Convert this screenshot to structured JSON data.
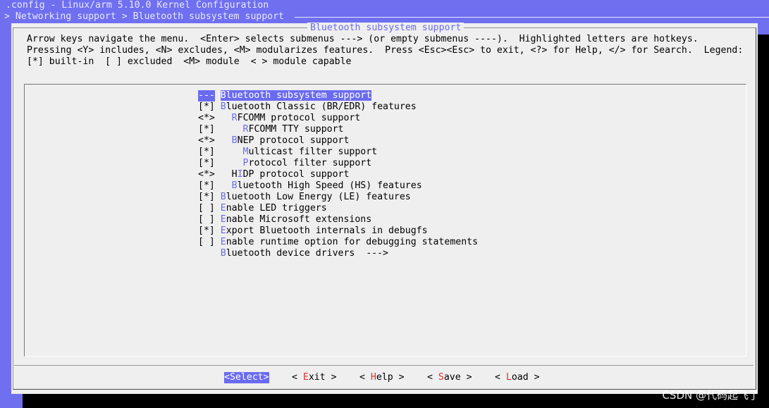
{
  "header": {
    "title": ".config - Linux/arm 5.10.0 Kernel Configuration",
    "breadcrumb": "> Networking support > Bluetooth subsystem support"
  },
  "dialog": {
    "title": "Bluetooth subsystem support",
    "help_lines": [
      "Arrow keys navigate the menu.  <Enter> selects submenus ---> (or empty submenus ----).  Highlighted letters are hotkeys.",
      "Pressing <Y> includes, <N> excludes, <M> modularizes features.  Press <Esc><Esc> to exit, <?> for Help, </> for Search.  Legend:",
      "[*] built-in  [ ] excluded  <M> module  < > module capable"
    ]
  },
  "menu": {
    "items": [
      {
        "mark": "---",
        "indent": "",
        "hotkey": "",
        "rest": "Bluetooth subsystem support",
        "selected": true
      },
      {
        "mark": "[*]",
        "indent": "",
        "hotkey": "B",
        "rest": "luetooth Classic (BR/EDR) features"
      },
      {
        "mark": "<*>",
        "indent": "  ",
        "hotkey": "R",
        "rest": "FCOMM protocol support"
      },
      {
        "mark": "[*]",
        "indent": "    ",
        "hotkey": "R",
        "rest": "FCOMM TTY support"
      },
      {
        "mark": "<*>",
        "indent": "  ",
        "hotkey": "B",
        "rest": "NEP protocol support"
      },
      {
        "mark": "[*]",
        "indent": "    ",
        "hotkey": "M",
        "rest": "ulticast filter support"
      },
      {
        "mark": "[*]",
        "indent": "    ",
        "hotkey": "P",
        "rest": "rotocol filter support"
      },
      {
        "mark": "<*>",
        "indent": "  ",
        "pre": "H",
        "hotkey": "I",
        "rest": "DP protocol support"
      },
      {
        "mark": "[*]",
        "indent": "  ",
        "hotkey": "B",
        "rest": "luetooth High Speed (HS) features"
      },
      {
        "mark": "[*]",
        "indent": "",
        "hotkey": "B",
        "rest": "luetooth Low Energy (LE) features"
      },
      {
        "mark": "[ ]",
        "indent": "",
        "hotkey": "E",
        "rest": "nable LED triggers"
      },
      {
        "mark": "[ ]",
        "indent": "",
        "hotkey": "E",
        "rest": "nable Microsoft extensions"
      },
      {
        "mark": "[*]",
        "indent": "",
        "hotkey": "E",
        "rest": "xport Bluetooth internals in debugfs"
      },
      {
        "mark": "[ ]",
        "indent": "",
        "hotkey": "E",
        "rest": "nable runtime option for debugging statements"
      },
      {
        "mark": "   ",
        "indent": "",
        "hotkey": "B",
        "rest": "luetooth device drivers  --->"
      }
    ]
  },
  "buttons": {
    "select": {
      "pre": "<",
      "hotkey": "S",
      "rest": "elect>"
    },
    "exit": {
      "pre": "< ",
      "hotkey": "E",
      "rest": "xit >"
    },
    "help": {
      "pre": "< ",
      "hotkey": "H",
      "rest": "elp >"
    },
    "save": {
      "pre": "< ",
      "hotkey": "S",
      "rest": "ave >"
    },
    "load": {
      "pre": "< ",
      "hotkey": "L",
      "rest": "oad >"
    }
  },
  "watermark": "CSDN @代码起飞了"
}
